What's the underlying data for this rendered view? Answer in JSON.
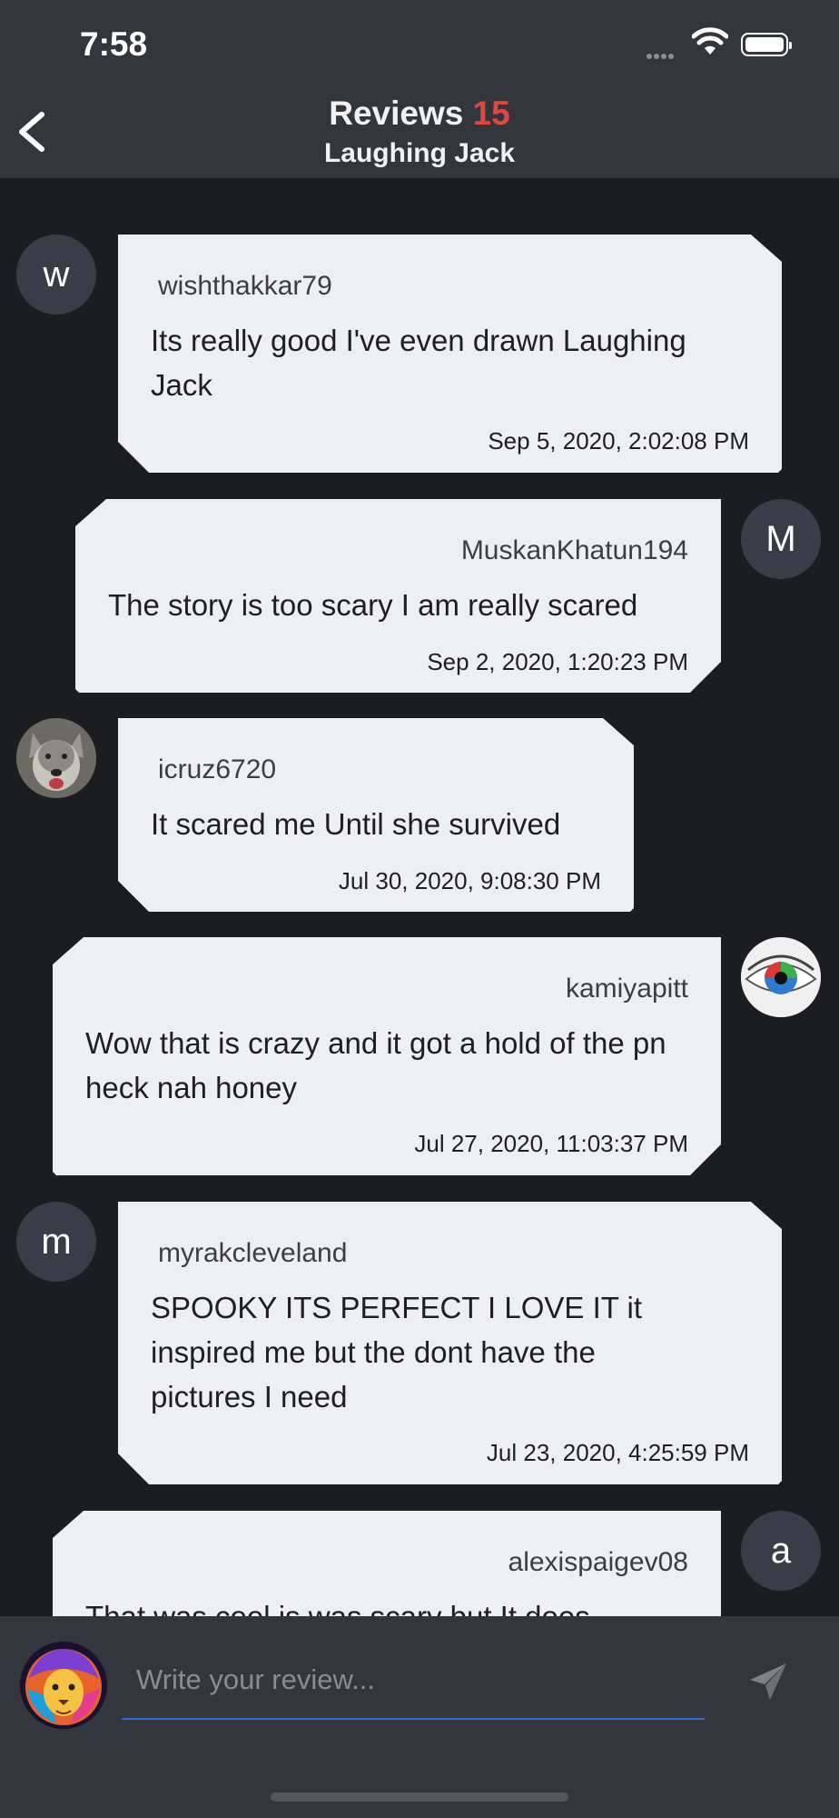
{
  "status_bar": {
    "time": "7:58"
  },
  "header": {
    "title": "Reviews",
    "count": "15",
    "subtitle": "Laughing Jack"
  },
  "reviews": [
    {
      "username": "wishthakkar79",
      "avatar_letter": "w",
      "text": "Its really good I've even drawn Laughing Jack",
      "date": "Sep 5, 2020, 2:02:08 PM"
    },
    {
      "username": "MuskanKhatun194",
      "avatar_letter": "M",
      "text": "The story is too scary I am really scared",
      "date": "Sep 2, 2020, 1:20:23 PM"
    },
    {
      "username": "icruz6720",
      "avatar_image": "wolf-photo",
      "text": "It scared me Until she survived",
      "date": "Jul 30, 2020, 9:08:30 PM"
    },
    {
      "username": "kamiyapitt",
      "avatar_image": "eye-photo",
      "text": "Wow that is crazy and it got a hold of the pn heck nah honey",
      "date": "Jul 27, 2020, 11:03:37 PM"
    },
    {
      "username": "myrakcleveland",
      "avatar_letter": "m",
      "text": "SPOOKY ITS PERFECT I LOVE IT it inspired me but the dont have the pictures I need",
      "date": "Jul 23, 2020, 4:25:59 PM"
    },
    {
      "username": "alexispaigev08",
      "avatar_letter": "a",
      "text": "That was cool is was scary but It does",
      "date": ""
    }
  ],
  "composer": {
    "placeholder": "Write your review...",
    "avatar_image": "lion-photo"
  },
  "colors": {
    "background": "#1c1d21",
    "bar": "#33363d",
    "bubble": "#eeeef5",
    "count_accent": "#e5463b",
    "input_underline": "#2c6ed8"
  },
  "icons": [
    "back-chevron-icon",
    "wifi-icon",
    "battery-icon",
    "send-icon"
  ]
}
